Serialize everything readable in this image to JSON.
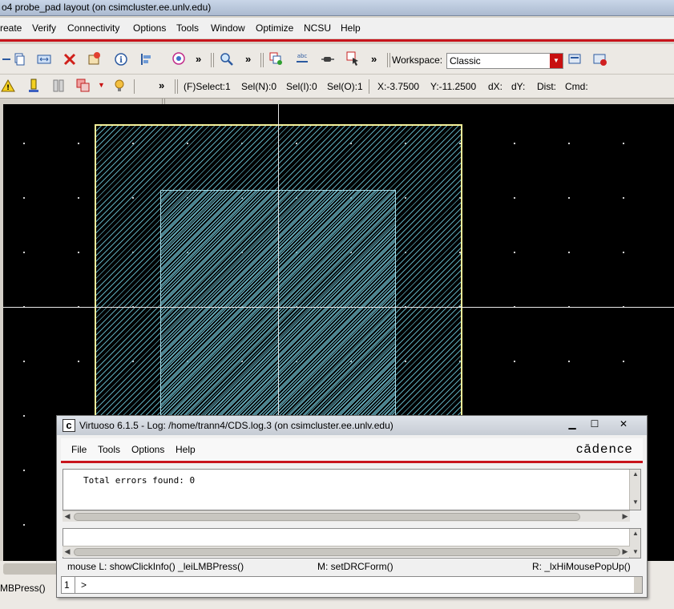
{
  "window": {
    "title": "o4 probe_pad layout (on csimcluster.ee.unlv.edu)"
  },
  "menubar": [
    "reate",
    "Verify",
    "Connectivity",
    "Options",
    "Tools",
    "Window",
    "Optimize",
    "NCSU",
    "Help"
  ],
  "toolbar": {
    "workspace_label": "Workspace:",
    "workspace_value": "Classic",
    "overflow": "»",
    "icons": [
      "copy-icon",
      "stretch-icon",
      "delete-icon",
      "properties-icon",
      "info-icon",
      "align-icon",
      "hierarchy-icon",
      "zoom-icon",
      "create-instance-icon",
      "label-icon",
      "pin-icon",
      "select-icon",
      "workspace-save-icon",
      "workspace-load-icon",
      "drc-warning-icon",
      "marker-icon",
      "ruler-icon",
      "layer-icon",
      "bulb-icon"
    ]
  },
  "status": {
    "select": "(F)Select:1",
    "sel_n": "Sel(N):0",
    "sel_i": "Sel(I):0",
    "sel_o": "Sel(O):1",
    "x": "X:-3.7500",
    "y": "Y:-11.2500",
    "dx": "dX:",
    "dy": "dY:",
    "dist": "Dist:",
    "cmd": "Cmd:"
  },
  "bottom": {
    "status": "MBPress()"
  },
  "log_window": {
    "title": "Virtuoso 6.1.5 - Log: /home/trann4/CDS.log.3 (on csimcluster.ee.unlv.edu)",
    "menu": [
      "File",
      "Tools",
      "Options",
      "Help"
    ],
    "logo": "cādence",
    "output": "Total errors found: 0",
    "mouse_l": "mouse L: showClickInfo() _leiLMBPress()",
    "mouse_m": "M: setDRCForm()",
    "mouse_r": "R: _lxHiMousePopUp()",
    "prompt_num": "1",
    "prompt": ">"
  },
  "colors": {
    "accent_red": "#c8141c",
    "canvas_bg": "#000000",
    "pad_outline": "#f6f29a",
    "pad_fill": "#5ea9b8"
  }
}
